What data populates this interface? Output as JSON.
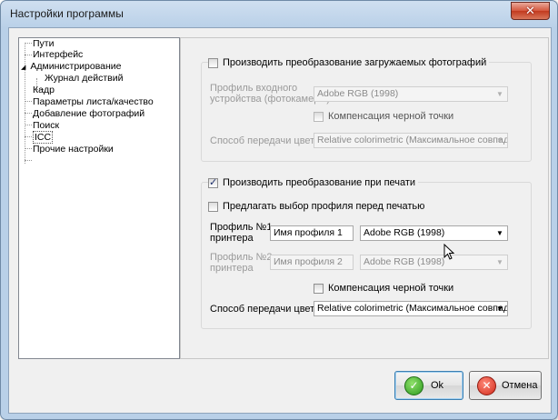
{
  "window": {
    "title": "Настройки программы",
    "close_glyph": "✕"
  },
  "tree": {
    "items": [
      {
        "label": "Пути"
      },
      {
        "label": "Интерфейс"
      },
      {
        "label": "Администрирование",
        "expander": "◢"
      },
      {
        "label": "Журнал действий"
      },
      {
        "label": "Кадр"
      },
      {
        "label": "Параметры листа/качество"
      },
      {
        "label": "Добавление фотографий"
      },
      {
        "label": "Поиск"
      },
      {
        "label": "ICC"
      },
      {
        "label": "Прочие настройки"
      }
    ]
  },
  "import_group": {
    "convert_label": "Производить преобразование загружаемых фотографий",
    "convert_checked": false,
    "input_profile_label_1": "Профиль входного",
    "input_profile_label_2": "устройства (фотокамеры)",
    "input_profile_value": "Adobe RGB (1998)",
    "black_point_label": "Компенсация черной точки",
    "black_point_checked": false,
    "intent_label": "Способ передачи цвета",
    "intent_value": "Relative colorimetric (Максимальное совпадение"
  },
  "print_group": {
    "convert_label": "Производить преобразование при печати",
    "convert_checked": true,
    "offer_profile_label": "Предлагать выбор профиля перед печатью",
    "offer_profile_checked": false,
    "printer1_label_1": "Профиль №1",
    "printer1_label_2": "принтера",
    "printer1_name": "Имя профиля 1",
    "printer1_profile": "Adobe RGB (1998)",
    "printer2_label_1": "Профиль №2",
    "printer2_label_2": "принтера",
    "printer2_name": "Имя профиля 2",
    "printer2_profile": "Adobe RGB (1998)",
    "black_point_label": "Компенсация черной точки",
    "black_point_checked": false,
    "intent_label": "Способ передачи цвета",
    "intent_value": "Relative colorimetric (Максимальное совпадение"
  },
  "buttons": {
    "ok_label": "Ok",
    "cancel_label": "Отмена"
  },
  "icons": {
    "ok": "check-icon",
    "cancel": "cancel-icon",
    "dropdown": "▼"
  },
  "colors": {
    "titlebar": "#b9d0e8",
    "close": "#c23a1f",
    "ok_icon": "#2c9a1e",
    "cancel_icon": "#d22a1a"
  }
}
